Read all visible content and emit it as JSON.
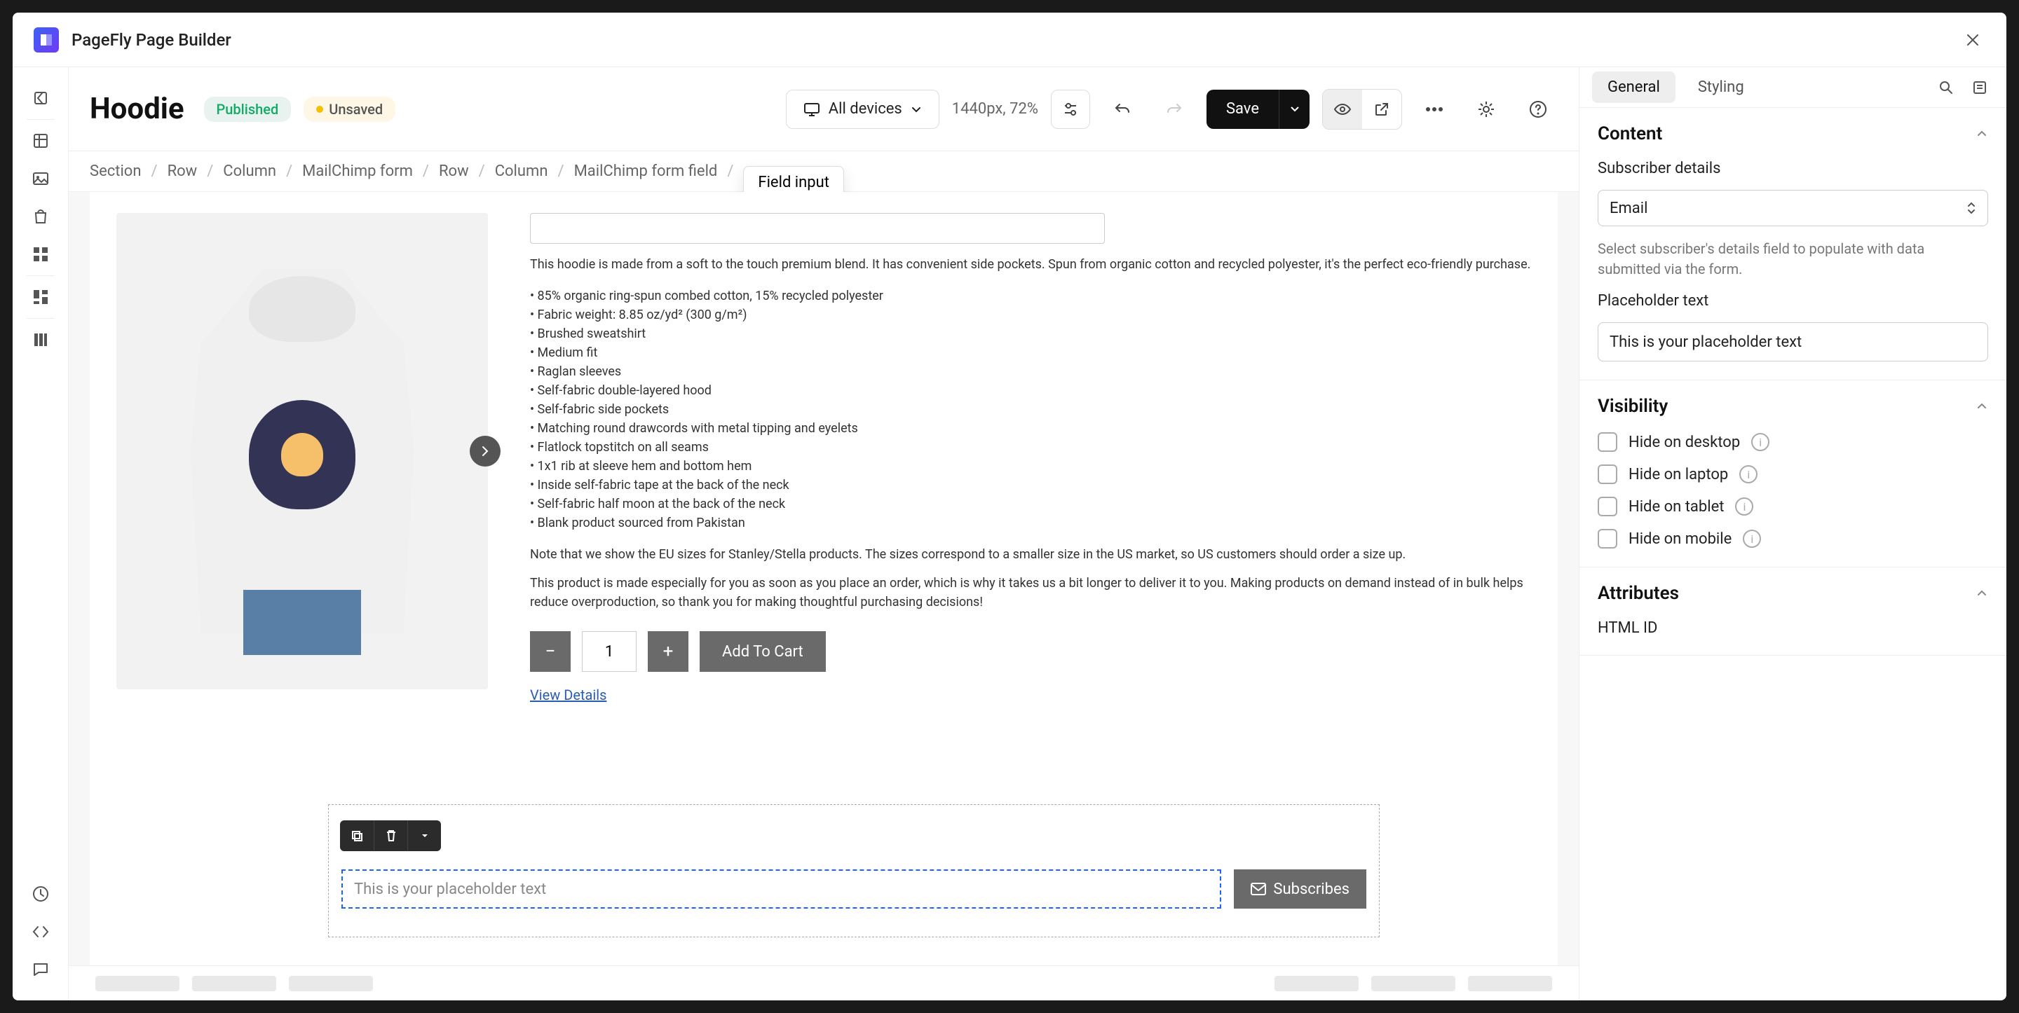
{
  "titlebar": {
    "app_name": "PageFly Page Builder"
  },
  "page": {
    "title": "Hoodie",
    "status_published": "Published",
    "status_unsaved": "Unsaved",
    "device_label": "All devices",
    "viewport_text": "1440px, 72%",
    "save_label": "Save"
  },
  "breadcrumbs": [
    "Section",
    "Row",
    "Column",
    "MailChimp form",
    "Row",
    "Column",
    "MailChimp form field",
    "Field input"
  ],
  "product": {
    "desc_intro": "This hoodie is made from a soft to the touch premium blend. It has convenient side pockets. Spun from organic cotton and recycled polyester, it's the perfect eco-friendly purchase.",
    "bullets": [
      "85% organic ring-spun combed cotton, 15% recycled polyester",
      "Fabric weight: 8.85 oz/yd² (300 g/m²)",
      "Brushed sweatshirt",
      "Medium fit",
      "Raglan sleeves",
      "Self-fabric double-layered hood",
      "Self-fabric side pockets",
      "Matching round drawcords with metal tipping and eyelets",
      "Flatlock topstitch on all seams",
      "1x1 rib at sleeve hem and bottom hem",
      "Inside self-fabric tape at the back of the neck",
      "Self-fabric half moon at the back of the neck",
      "Blank product sourced from Pakistan"
    ],
    "note1": "Note that we show the EU sizes for Stanley/Stella products. The sizes correspond to a smaller size in the US market, so US customers should order a size up.",
    "note2": "This product is made especially for you as soon as you place an order, which is why it takes us a bit longer to deliver it to you. Making products on demand instead of in bulk helps reduce overproduction, so thank you for making thoughtful purchasing decisions!",
    "qty_value": "1",
    "add_to_cart": "Add To Cart",
    "view_details": "View Details"
  },
  "form": {
    "placeholder_preview": "This is your placeholder text",
    "subscribe_label": "Subscribes"
  },
  "panel": {
    "tab_general": "General",
    "tab_styling": "Styling",
    "content": {
      "title": "Content",
      "sub_label": "Subscriber details",
      "sub_value": "Email",
      "help": "Select subscriber's details field to populate with data submitted via the form.",
      "placeholder_label": "Placeholder text",
      "placeholder_value": "This is your placeholder text"
    },
    "visibility": {
      "title": "Visibility",
      "hide_desktop": "Hide on desktop",
      "hide_laptop": "Hide on laptop",
      "hide_tablet": "Hide on tablet",
      "hide_mobile": "Hide on mobile"
    },
    "attributes": {
      "title": "Attributes",
      "html_id": "HTML ID"
    }
  }
}
